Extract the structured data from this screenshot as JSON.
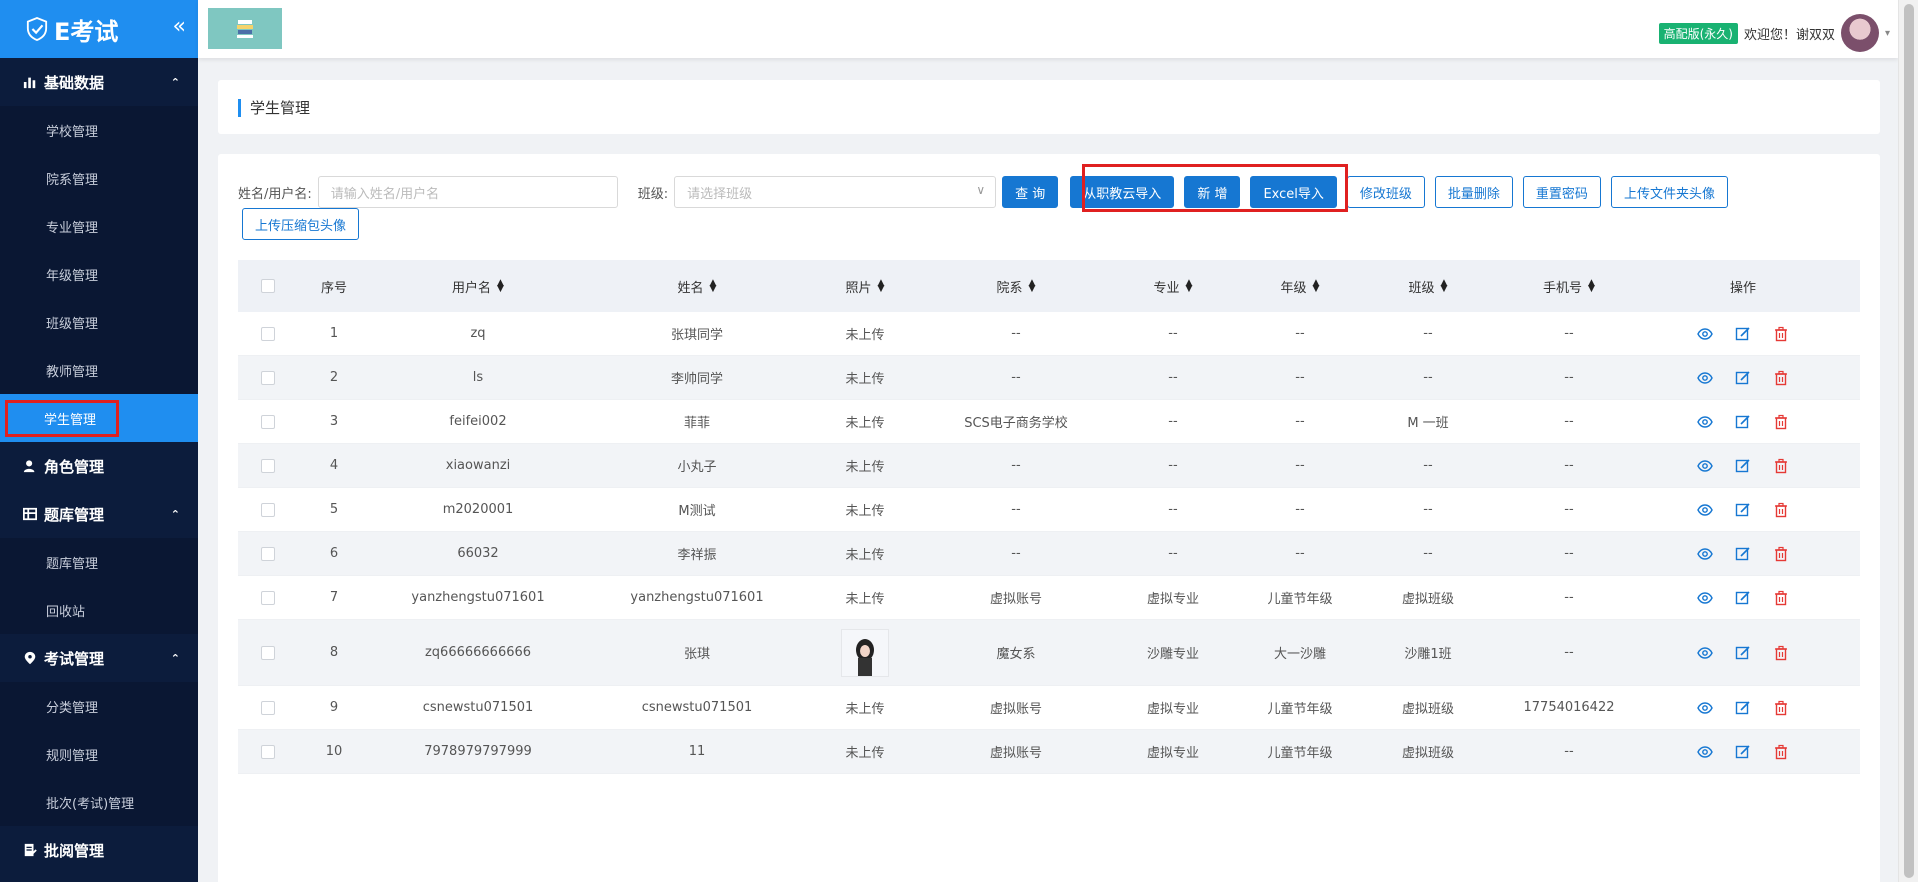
{
  "sidebar": {
    "logo_text": "E考试",
    "collapse_icon": "«",
    "groups": [
      {
        "label": "基础数据",
        "icon": "bar-chart-icon",
        "expanded": true
      },
      {
        "label": "角色管理",
        "icon": "user-icon",
        "expanded": false
      },
      {
        "label": "题库管理",
        "icon": "table-icon",
        "expanded": true
      },
      {
        "label": "考试管理",
        "icon": "map-pin-icon",
        "expanded": true
      },
      {
        "label": "批阅管理",
        "icon": "edit-doc-icon",
        "expanded": false
      }
    ],
    "basic_items": [
      "学校管理",
      "院系管理",
      "专业管理",
      "年级管理",
      "班级管理",
      "教师管理",
      "学生管理"
    ],
    "bank_items": [
      "题库管理",
      "回收站"
    ],
    "exam_items": [
      "分类管理",
      "规则管理",
      "批次(考试)管理"
    ],
    "active_item": "学生管理"
  },
  "header": {
    "edition_badge": "高配版(永久)",
    "welcome": "欢迎您！谢双双"
  },
  "page_title": "学生管理",
  "filters": {
    "name_label": "姓名/用户名:",
    "name_placeholder": "请输入姓名/用户名",
    "class_label": "班级:",
    "class_placeholder": "请选择班级"
  },
  "buttons": {
    "query": "查 询",
    "import_cloud": "从职教云导入",
    "add": "新 增",
    "excel_import": "Excel导入",
    "modify_class": "修改班级",
    "batch_delete": "批量删除",
    "reset_password": "重置密码",
    "upload_folder_avatar": "上传文件夹头像",
    "upload_zip_avatar": "上传压缩包头像"
  },
  "table": {
    "columns": [
      "序号",
      "用户名",
      "姓名",
      "照片",
      "院系",
      "专业",
      "年级",
      "班级",
      "手机号",
      "操作"
    ],
    "rows": [
      {
        "no": "1",
        "username": "zq",
        "name": "张琪同学",
        "photo": "未上传",
        "dept": "--",
        "major": "--",
        "grade": "--",
        "class": "--",
        "phone": "--"
      },
      {
        "no": "2",
        "username": "ls",
        "name": "李帅同学",
        "photo": "未上传",
        "dept": "--",
        "major": "--",
        "grade": "--",
        "class": "--",
        "phone": "--"
      },
      {
        "no": "3",
        "username": "feifei002",
        "name": "菲菲",
        "photo": "未上传",
        "dept": "SCS电子商务学校",
        "major": "--",
        "grade": "--",
        "class": "M 一班",
        "phone": "--"
      },
      {
        "no": "4",
        "username": "xiaowanzi",
        "name": "小丸子",
        "photo": "未上传",
        "dept": "--",
        "major": "--",
        "grade": "--",
        "class": "--",
        "phone": "--"
      },
      {
        "no": "5",
        "username": "m2020001",
        "name": "M测试",
        "photo": "未上传",
        "dept": "--",
        "major": "--",
        "grade": "--",
        "class": "--",
        "phone": "--"
      },
      {
        "no": "6",
        "username": "66032",
        "name": "李祥振",
        "photo": "未上传",
        "dept": "--",
        "major": "--",
        "grade": "--",
        "class": "--",
        "phone": "--"
      },
      {
        "no": "7",
        "username": "yanzhengstu071601",
        "name": "yanzhengstu071601",
        "photo": "未上传",
        "dept": "虚拟账号",
        "major": "虚拟专业",
        "grade": "儿童节年级",
        "class": "虚拟班级",
        "phone": "--"
      },
      {
        "no": "8",
        "username": "zq66666666666",
        "name": "张琪",
        "photo": "",
        "dept": "魔女系",
        "major": "沙雕专业",
        "grade": "大一沙雕",
        "class": "沙雕1班",
        "phone": "--"
      },
      {
        "no": "9",
        "username": "csnewstu071501",
        "name": "csnewstu071501",
        "photo": "未上传",
        "dept": "虚拟账号",
        "major": "虚拟专业",
        "grade": "儿童节年级",
        "class": "虚拟班级",
        "phone": "17754016422"
      },
      {
        "no": "10",
        "username": "7978979797999",
        "name": "11",
        "photo": "未上传",
        "dept": "虚拟账号",
        "major": "虚拟专业",
        "grade": "儿童节年级",
        "class": "虚拟班级",
        "phone": "--"
      }
    ]
  },
  "colors": {
    "sidebar_bg": "#0c1c3c",
    "accent": "#1f8ef0",
    "primary_button": "#1677d2",
    "highlight_red": "#e02020",
    "badge_green": "#19b272",
    "delete_red": "#e53935"
  }
}
